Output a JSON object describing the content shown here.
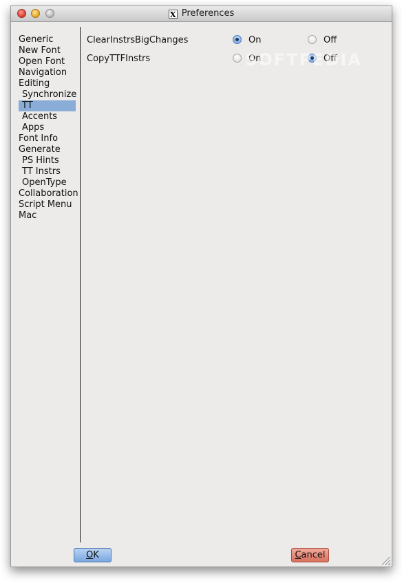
{
  "window": {
    "title": "Preferences",
    "title_icon": "x11-icon"
  },
  "sidebar": {
    "items": [
      {
        "label": "Generic",
        "indent": false,
        "selected": false
      },
      {
        "label": "New Font",
        "indent": false,
        "selected": false
      },
      {
        "label": "Open Font",
        "indent": false,
        "selected": false
      },
      {
        "label": "Navigation",
        "indent": false,
        "selected": false
      },
      {
        "label": "Editing",
        "indent": false,
        "selected": false
      },
      {
        "label": "Synchronize",
        "indent": true,
        "selected": false
      },
      {
        "label": "TT",
        "indent": true,
        "selected": true
      },
      {
        "label": "Accents",
        "indent": true,
        "selected": false
      },
      {
        "label": "Apps",
        "indent": true,
        "selected": false
      },
      {
        "label": "Font Info",
        "indent": false,
        "selected": false
      },
      {
        "label": "Generate",
        "indent": false,
        "selected": false
      },
      {
        "label": "PS Hints",
        "indent": true,
        "selected": false
      },
      {
        "label": "TT Instrs",
        "indent": true,
        "selected": false
      },
      {
        "label": "OpenType",
        "indent": true,
        "selected": false
      },
      {
        "label": "Collaboration",
        "indent": false,
        "selected": false
      },
      {
        "label": "Script Menu",
        "indent": false,
        "selected": false
      },
      {
        "label": "Mac",
        "indent": false,
        "selected": false
      }
    ]
  },
  "options": [
    {
      "label": "ClearInstrsBigChanges",
      "on_label": "On",
      "off_label": "Off",
      "value": "On"
    },
    {
      "label": "CopyTTFInstrs",
      "on_label": "On",
      "off_label": "Off",
      "value": "Off"
    }
  ],
  "watermark": "SOFTPEDIA",
  "buttons": {
    "ok_mnemonic": "O",
    "ok_rest": "K",
    "cancel_mnemonic": "C",
    "cancel_rest": "ancel"
  },
  "colors": {
    "selection": "#8aadd8",
    "ok_button": "#7aa7e0",
    "cancel_button": "#d9705d"
  }
}
